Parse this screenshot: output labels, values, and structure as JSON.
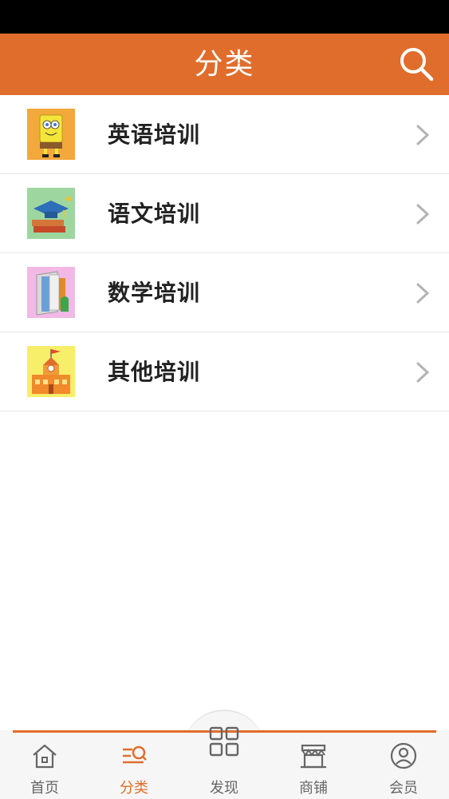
{
  "header": {
    "title": "分类",
    "search_icon": "search-icon"
  },
  "categories": [
    {
      "label": "英语培训",
      "icon": "sponge-cartoon-thumbnail"
    },
    {
      "label": "语文培训",
      "icon": "graduation-cap-books-thumbnail"
    },
    {
      "label": "数学培训",
      "icon": "books-thumbnail"
    },
    {
      "label": "其他培训",
      "icon": "school-building-thumbnail"
    }
  ],
  "tabbar": {
    "items": [
      {
        "label": "首页",
        "icon": "home-icon"
      },
      {
        "label": "分类",
        "icon": "category-icon"
      },
      {
        "label": "发现",
        "icon": "grid-icon"
      },
      {
        "label": "商铺",
        "icon": "shop-icon"
      },
      {
        "label": "会员",
        "icon": "user-icon"
      }
    ],
    "active": "分类"
  },
  "colors": {
    "accent": "#e06d2c",
    "header_bg": "#e06d2c",
    "tab_inactive": "#666666"
  }
}
